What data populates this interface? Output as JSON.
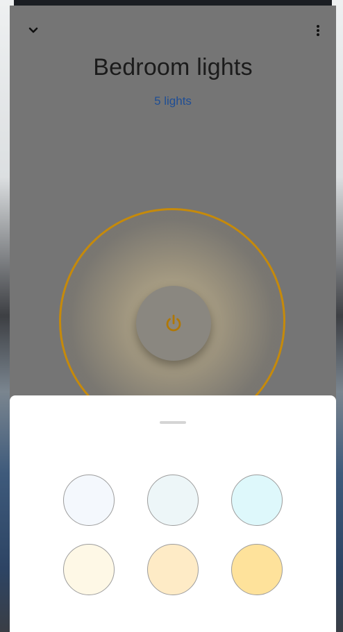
{
  "header": {
    "title": "Bedroom lights",
    "subtitle": "5 lights",
    "collapse_icon": "chevron-down-icon",
    "menu_icon": "more-vert-icon"
  },
  "control": {
    "power_icon": "power-icon",
    "accent_color": "#c68a0a"
  },
  "colors": {
    "swatches": [
      "#f4f8fd",
      "#edf6f8",
      "#def8fb",
      "#fef8e6",
      "#feebc6",
      "#fee29b"
    ]
  }
}
